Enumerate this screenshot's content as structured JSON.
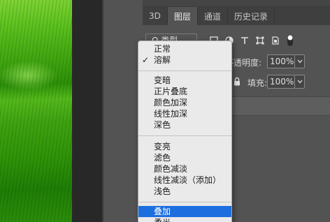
{
  "tabs": [
    {
      "label": "3D",
      "active": false
    },
    {
      "label": "图层",
      "active": true
    },
    {
      "label": "通道",
      "active": false
    },
    {
      "label": "历史记录",
      "active": false
    }
  ],
  "filter": {
    "label": "Q 类型"
  },
  "opacity": {
    "label": "不透明度:",
    "value": "100%"
  },
  "fill": {
    "label": "填充:",
    "value": "100%"
  },
  "blend_menu": {
    "groups": [
      [
        "正常",
        "溶解"
      ],
      [
        "变暗",
        "正片叠底",
        "颜色加深",
        "线性加深",
        "深色"
      ],
      [
        "变亮",
        "滤色",
        "颜色减淡",
        "线性减淡（添加）",
        "浅色"
      ],
      [
        "叠加",
        "柔光"
      ]
    ],
    "checked_item": "溶解",
    "highlighted_item": "叠加"
  },
  "colors": {
    "accent": "#1d6fe0",
    "panel": "#535353",
    "menu_bg": "#eaeaea"
  }
}
